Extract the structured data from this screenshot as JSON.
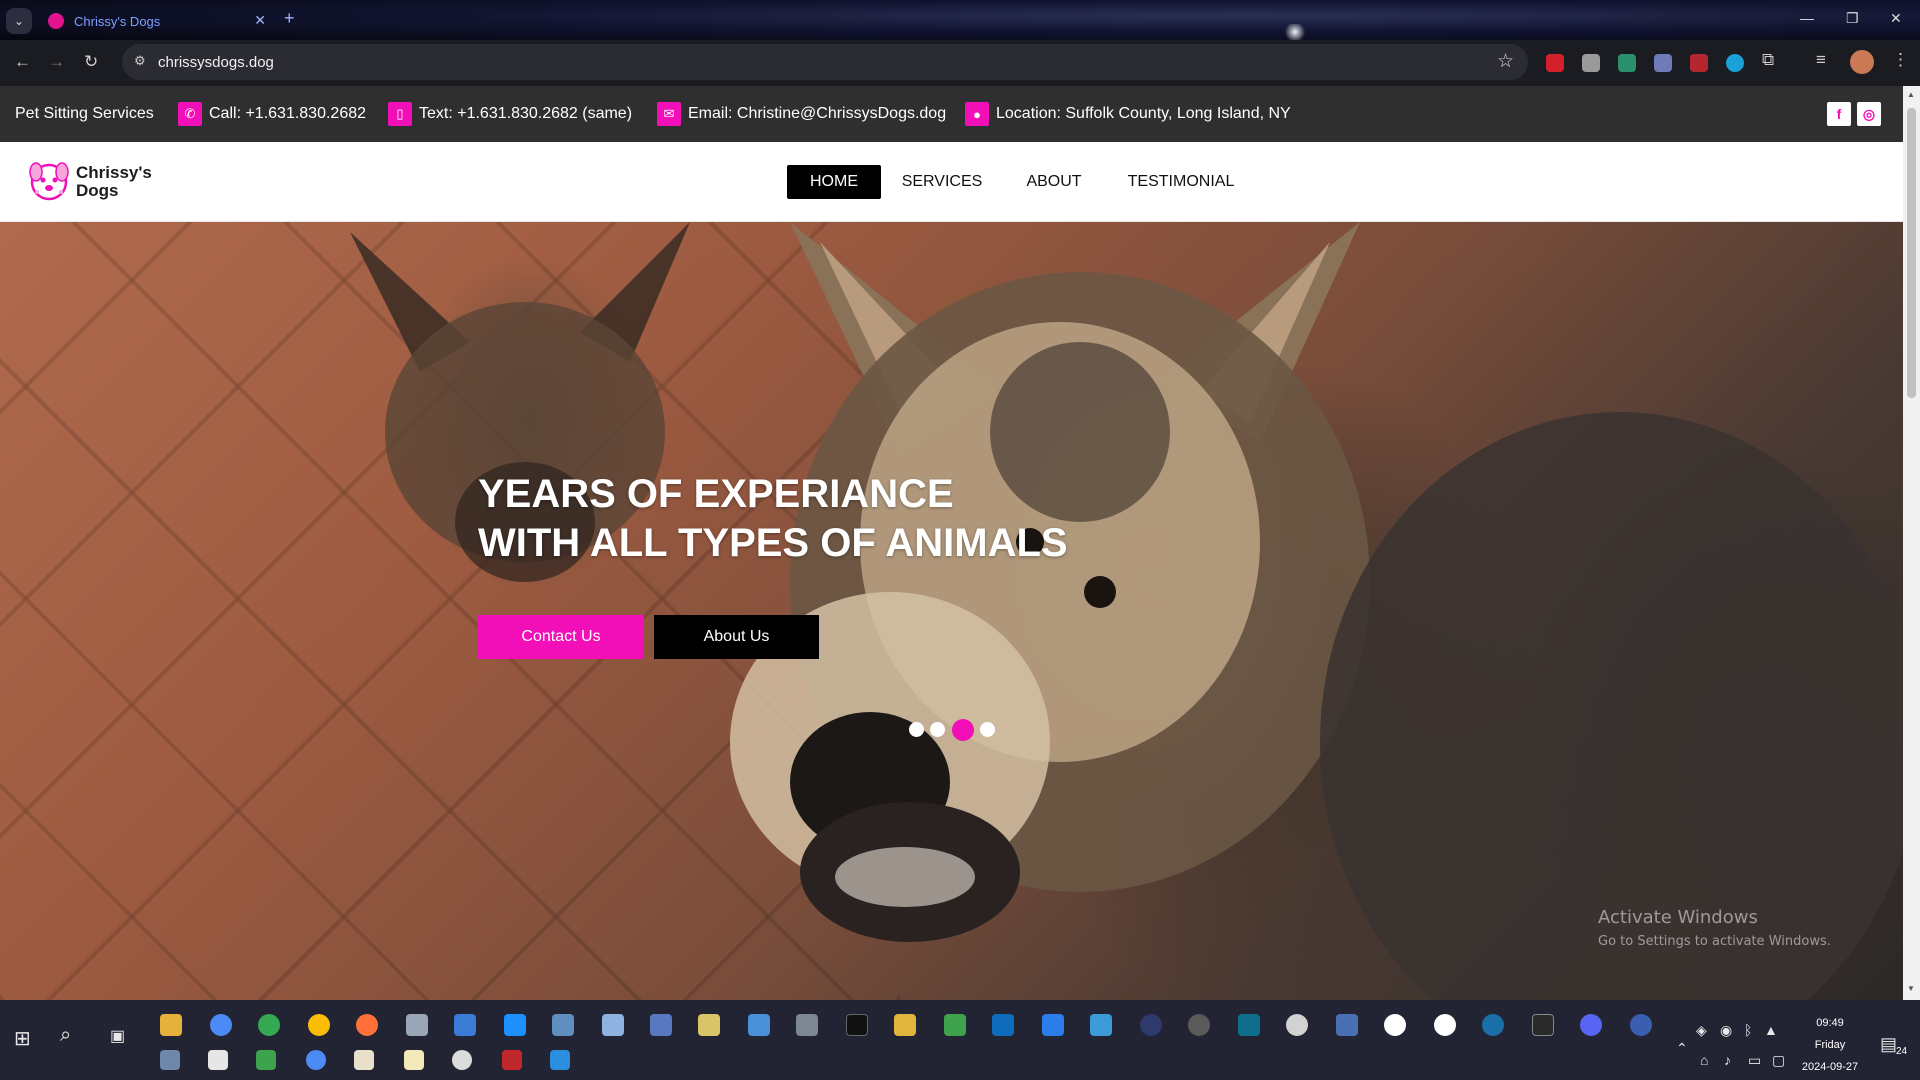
{
  "browser": {
    "tab_title": "Chrissy's Dogs",
    "url": "chrissysdogs.dog"
  },
  "topbar": {
    "brand": "Pet Sitting Services",
    "call": "Call: +1.631.830.2682",
    "text": "Text: +1.631.830.2682 (same)",
    "email": "Email: Christine@ChrissysDogs.dog",
    "location": "Location: Suffolk County, Long Island, NY",
    "social": [
      "facebook-icon",
      "instagram-icon"
    ],
    "accent": "#f20fb8"
  },
  "header": {
    "logo_line1": "Chrissy's",
    "logo_line2": "Dogs",
    "nav": [
      {
        "label": "HOME",
        "active": true
      },
      {
        "label": "SERVICES",
        "active": false
      },
      {
        "label": "ABOUT",
        "active": false
      },
      {
        "label": "TESTIMONIAL",
        "active": false
      }
    ]
  },
  "hero": {
    "title_line1": "YEARS OF EXPERIANCE",
    "title_line2": "WITH ALL TYPES OF ANIMALS",
    "contact_button": "Contact Us",
    "about_button": "About Us",
    "slides": 4,
    "active_slide": 3
  },
  "watermark": {
    "line1": "Activate Windows",
    "line2": "Go to Settings to activate Windows."
  },
  "taskbar": {
    "time": "09:49",
    "day": "Friday",
    "date": "2024-09-27",
    "notifications": "24"
  }
}
